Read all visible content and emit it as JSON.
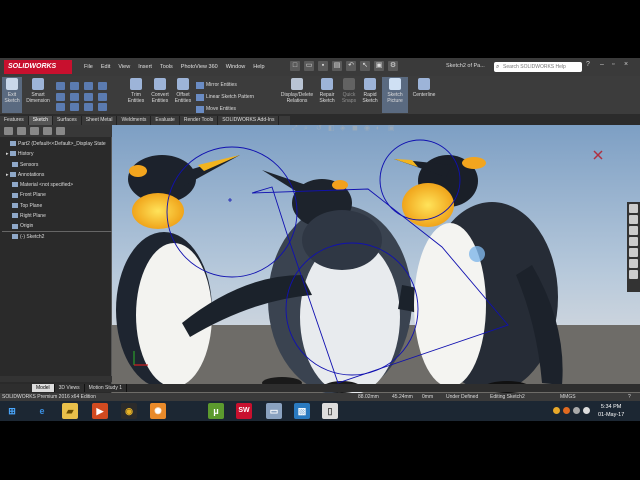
{
  "app": {
    "brand": "SOLIDWORKS",
    "menus": [
      "File",
      "Edit",
      "View",
      "Insert",
      "Tools",
      "PhotoView 360",
      "Window",
      "Help"
    ],
    "document_title": "Sketch2 of Pa...",
    "search_placeholder": "Search SOLIDWORKS Help"
  },
  "ribbon": {
    "buttons": [
      {
        "label": "Exit Sketch"
      },
      {
        "label": "Smart Dimension"
      },
      {
        "label": "Trim Entities"
      },
      {
        "label": "Convert Entities"
      },
      {
        "label": "Offset Entities"
      },
      {
        "label": "Display/Delete Relations"
      },
      {
        "label": "Repair Sketch"
      },
      {
        "label": "Quick Snaps"
      },
      {
        "label": "Rapid Sketch"
      },
      {
        "label": "Sketch Picture"
      },
      {
        "label": "Centerline"
      }
    ],
    "list_items": [
      "Mirror Entities",
      "Linear Sketch Pattern",
      "Move Entities"
    ]
  },
  "command_tabs": [
    "Features",
    "Sketch",
    "Surfaces",
    "Sheet Metal",
    "Weldments",
    "Evaluate",
    "Render Tools",
    "SOLIDWORKS Add-Ins"
  ],
  "active_tab": "Sketch",
  "feature_tree": [
    {
      "label": "Part2  (Default<<Default>_Display State"
    },
    {
      "label": "History"
    },
    {
      "label": "Sensors"
    },
    {
      "label": "Annotations"
    },
    {
      "label": "Material <not specified>"
    },
    {
      "label": "Front Plane"
    },
    {
      "label": "Top Plane"
    },
    {
      "label": "Right Plane"
    },
    {
      "label": "Origin"
    },
    {
      "label": "(-) Sketch2"
    }
  ],
  "bottom_tabs": [
    "Model",
    "3D Views",
    "Motion Study 1"
  ],
  "status": {
    "edition": "SOLIDWORKS Premium 2016 x64 Edition",
    "x": "88.02mm",
    "y": "45.24mm",
    "z": "0mm",
    "definition": "Under Defined",
    "mode": "Editing Sketch2",
    "units": "MMGS"
  },
  "taskbar": {
    "time": "5:34 PM",
    "date": "01-May-17"
  },
  "colors": {
    "brand_red": "#c8102e",
    "sketch_blue": "#1010b0",
    "ui_dark": "#2b2b2b"
  }
}
